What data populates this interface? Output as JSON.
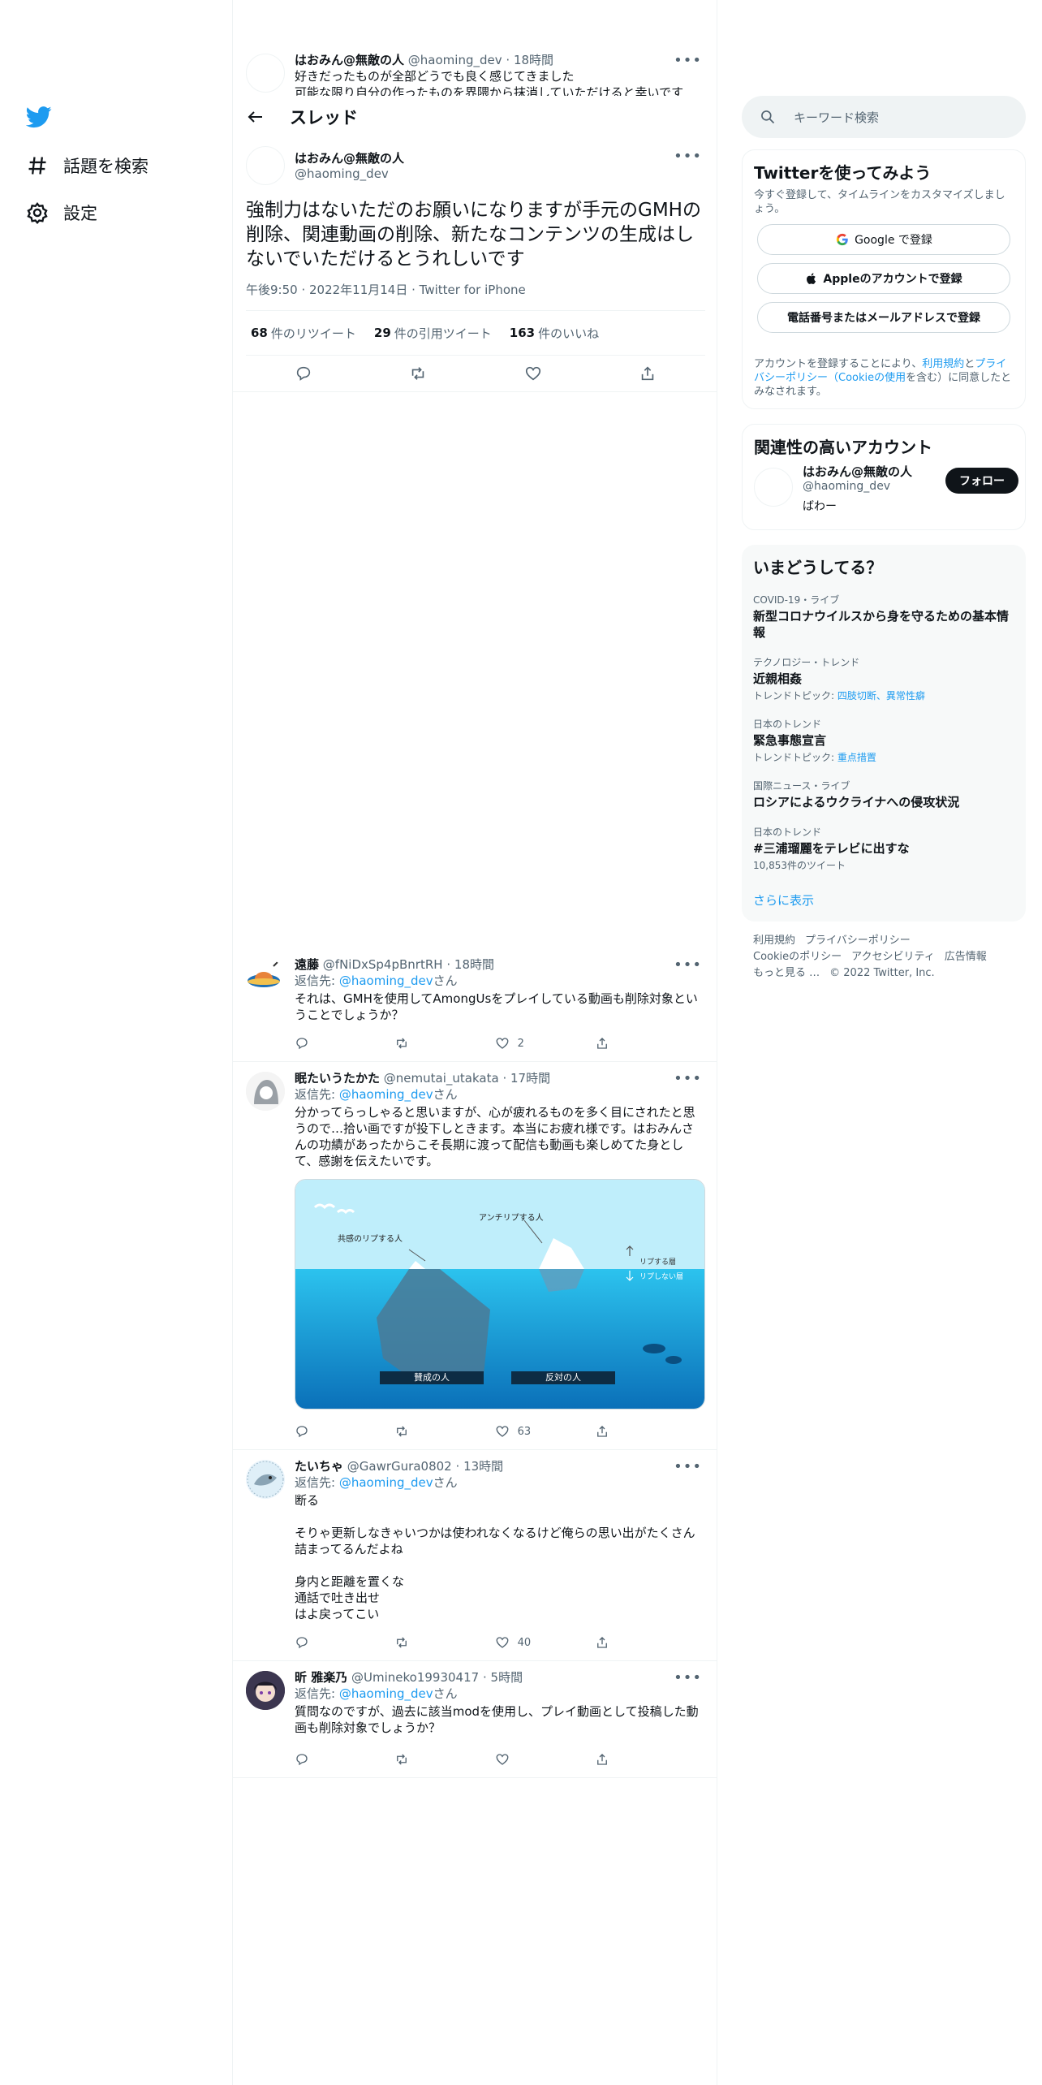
{
  "sidebar": {
    "explore_label": "話題を検索",
    "settings_label": "設定"
  },
  "partial_tweet": {
    "name": "はおみん@無敵の人",
    "handle": "@haoming_dev",
    "time": "18時間",
    "line1": "好きだったものが全部どうでも良く感じてきました",
    "line2": "可能な限り自分の作ったものを界隈から抹消していただけると幸いです"
  },
  "header": {
    "title": "スレッド"
  },
  "main_tweet": {
    "name": "はおみん@無敵の人",
    "handle": "@haoming_dev",
    "text": "強制力はないただのお願いになりますが手元のGMHの削除、関連動画の削除、新たなコンテンツの生成はしないでいただけるとうれしいです",
    "time": "午後9:50",
    "date": "2022年11月14日",
    "source": "Twitter for iPhone",
    "retweets": "68",
    "retweets_label": "件のリツイート",
    "quotes": "29",
    "quotes_label": "件の引用ツイート",
    "likes": "163",
    "likes_label": "件のいいね"
  },
  "replies": [
    {
      "name": "遠藤",
      "handle": "@fNiDxSp4pBnrtRH",
      "time": "18時間",
      "replyto_prefix": "返信先: ",
      "replyto_handle": "@haoming_dev",
      "replyto_suffix": "さん",
      "text": "それは、GMHを使用してAmongUsをプレイしている動画も削除対象ということでしょうか？",
      "likes": "2"
    },
    {
      "name": "眠たいうたかた",
      "handle": "@nemutai_utakata",
      "time": "17時間",
      "replyto_prefix": "返信先: ",
      "replyto_handle": "@haoming_dev",
      "replyto_suffix": "さん",
      "text": "分かってらっしゃると思いますが、心が疲れるものを多く目にされたと思うので…拾い画ですが投下しときます。本当にお疲れ様です。はおみんさんの功績があったからこそ長期に渡って配信も動画も楽しめてた身として、感謝を伝えたいです。",
      "likes": "63",
      "image": {
        "label_left": "共感のリプする人",
        "label_right": "アンチリプする人",
        "legend_up": "リプする層",
        "legend_down": "リプしない層",
        "box_left": "賛成の人",
        "box_right": "反対の人"
      }
    },
    {
      "name": "たいちゃ",
      "handle": "@GawrGura0802",
      "time": "13時間",
      "replyto_prefix": "返信先: ",
      "replyto_handle": "@haoming_dev",
      "replyto_suffix": "さん",
      "text": "断る\n\nそりゃ更新しなきゃいつかは使われなくなるけど俺らの思い出がたくさん詰まってるんだよね\n\n身内と距離を置くな\n通話で吐き出せ\nはよ戻ってこい",
      "likes": "40"
    },
    {
      "name": "昕 雅楽乃",
      "handle": "@Umineko19930417",
      "time": "5時間",
      "replyto_prefix": "返信先: ",
      "replyto_handle": "@haoming_dev",
      "replyto_suffix": "さん",
      "text": "質問なのですが、過去に該当modを使用し、プレイ動画として投稿した動画も削除対象でしょうか？",
      "likes": ""
    }
  ],
  "right": {
    "search_placeholder": "キーワード検索",
    "signup": {
      "title": "Twitterを使ってみよう",
      "subtitle": "今すぐ登録して、タイムラインをカスタマイズしましょう。",
      "google": "Google で登録",
      "apple": "Appleのアカウントで登録",
      "phone": "電話番号またはメールアドレスで登録",
      "terms_prefix": "アカウントを登録することにより、",
      "terms_link1": "利用規約",
      "terms_mid": "と",
      "terms_link2": "プライバシーポリシー（Cookieの使用",
      "terms_suffix": "を含む）に同意したとみなされます。"
    },
    "related": {
      "title": "関連性の高いアカウント",
      "name": "はおみん@無敵の人",
      "handle": "@haoming_dev",
      "bio": "ばわー",
      "follow": "フォロー"
    },
    "trends": {
      "title": "いまどうしてる？",
      "items": [
        {
          "cat": "COVID-19・ライブ",
          "name": "新型コロナウイルスから身を守るための基本情報",
          "extra_label": "",
          "extra_link": ""
        },
        {
          "cat": "テクノロジー・トレンド",
          "name": "近親相姦",
          "extra_label": "トレンドトピック: ",
          "extra_link": "四肢切断、異常性癖"
        },
        {
          "cat": "日本のトレンド",
          "name": "緊急事態宣言",
          "extra_label": "トレンドトピック: ",
          "extra_link": "重点措置"
        },
        {
          "cat": "国際ニュース・ライブ",
          "name": "ロシアによるウクライナへの侵攻状況",
          "extra_label": "",
          "extra_link": ""
        },
        {
          "cat": "日本のトレンド",
          "name": "#三浦瑠麗をテレビに出すな",
          "extra_label": "10,853件のツイート",
          "extra_link": ""
        }
      ],
      "more": "さらに表示"
    },
    "footer": {
      "terms": "利用規約",
      "privacy": "プライバシーポリシー",
      "cookie": "Cookieのポリシー",
      "accessibility": "アクセシビリティ",
      "ads": "広告情報",
      "more": "もっと見る …",
      "copyright": "© 2022 Twitter, Inc."
    }
  },
  "colors": {
    "accent": "#1d9bf0",
    "text": "#0f1419",
    "muted": "#536471",
    "border": "#eff3f4"
  }
}
